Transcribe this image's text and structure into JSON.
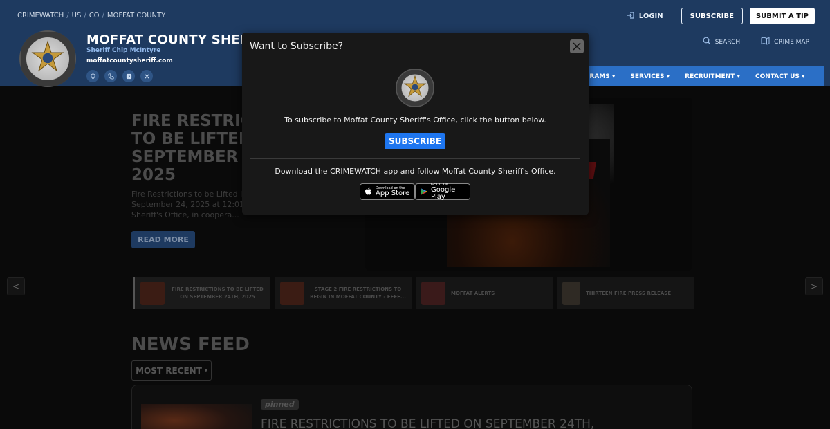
{
  "breadcrumb": [
    "CRIMEWATCH",
    "US",
    "CO",
    "MOFFAT COUNTY"
  ],
  "header": {
    "title": "MOFFAT COUNTY SHERIFF",
    "sheriff": "Sheriff Chip McIntyre",
    "url": "moffatcountysheriff.com",
    "login": "LOGIN",
    "subscribe": "SUBSCRIBE",
    "submit_tip": "SUBMIT A TIP",
    "search": "SEARCH",
    "crime_map": "CRIME MAP"
  },
  "nav": [
    {
      "label": "GRAMS"
    },
    {
      "label": "SERVICES"
    },
    {
      "label": "RECRUITMENT"
    },
    {
      "label": "CONTACT US"
    }
  ],
  "hero": {
    "title": "FIRE RESTRICTIONS TO BE LIFTED ON SEPTEMBER 24TH, 2025",
    "excerpt": "Fire Restrictions to be Lifted in Moffat County, effective September 24, 2025 at 12:01 AM. The Moffat County Sheriff's Office, in coopera...",
    "read_more": "READ MORE"
  },
  "carousel": [
    {
      "title": "FIRE RESTRICTIONS TO BE LIFTED ON SEPTEMBER 24TH, 2025"
    },
    {
      "title": "STAGE 2 FIRE RESTRICTIONS TO BEGIN IN MOFFAT COUNTY - EFFE..."
    },
    {
      "title": "MOFFAT ALERTS"
    },
    {
      "title": "THIRTEEN FIRE PRESS RELEASE"
    }
  ],
  "news": {
    "heading": "NEWS FEED",
    "sort": "MOST RECENT",
    "card": {
      "badge": "pinned",
      "title": "FIRE RESTRICTIONS TO BE LIFTED ON SEPTEMBER 24TH,"
    }
  },
  "modal": {
    "title": "Want to Subscribe?",
    "text": "To subscribe to Moffat County Sheriff's Office, click the button below.",
    "button": "SUBSCRIBE",
    "app_text": "Download the CRIMEWATCH app and follow Moffat County Sheriff's Office.",
    "app_store_small": "Download on the",
    "app_store_large": "App Store",
    "play_small": "GET IT ON",
    "play_large": "Google Play"
  },
  "colors": {
    "header_bg": "#1e3a60",
    "nav_bg": "#2b6fc6",
    "subscribe_btn": "#1e76f0"
  }
}
